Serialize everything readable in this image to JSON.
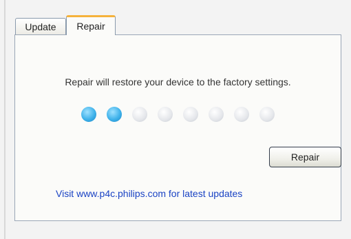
{
  "tabs": [
    {
      "label": "Update",
      "active": false
    },
    {
      "label": "Repair",
      "active": true
    }
  ],
  "panel": {
    "message": "Repair will restore your device to the factory settings.",
    "progress": {
      "completed_steps": 2,
      "total_steps": 8
    },
    "repair_button_label": "Repair",
    "link_text": "Visit www.p4c.philips.com for latest updates"
  },
  "colors": {
    "active_tab_accent": "#f5b23b",
    "progress_filled": "#3fb2ea",
    "progress_empty": "#e4e6ea",
    "link": "#1a43c4"
  }
}
